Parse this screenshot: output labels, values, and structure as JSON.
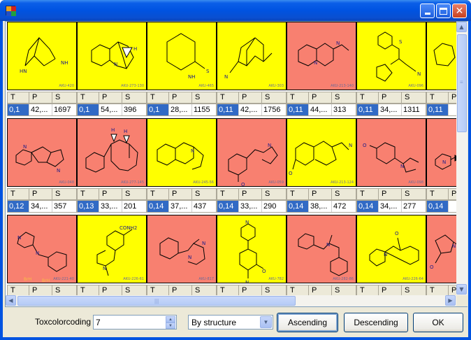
{
  "window": {
    "title": "",
    "icon_name": "app-icon",
    "icon_colors": [
      "#e8a21a",
      "#d02020",
      "#2050c8",
      "#20a040"
    ]
  },
  "colors": {
    "toxic": "#f88070",
    "nontoxic": "#ffff00",
    "selected": "#316ac5"
  },
  "grid": {
    "column_headers": [
      "T",
      "P",
      "S"
    ],
    "rows": [
      {
        "cells": [
          {
            "tox": "nontoxic",
            "code": "AKU-420",
            "t": "0,1",
            "p": "42,...",
            "s": "1697"
          },
          {
            "tox": "nontoxic",
            "code": "AKU-273-130",
            "t": "0,1",
            "p": "54,...",
            "s": "396"
          },
          {
            "tox": "nontoxic",
            "code": "AKU-465",
            "t": "0,1",
            "p": "28,...",
            "s": "1155"
          },
          {
            "tox": "nontoxic",
            "code": "AKU-303",
            "t": "0,11",
            "p": "42,...",
            "s": "1756"
          },
          {
            "tox": "toxic",
            "code": "AKU-213-140",
            "t": "0,11",
            "p": "44,...",
            "s": "313"
          },
          {
            "tox": "nontoxic",
            "code": "AKU-096",
            "t": "0,11",
            "p": "34,...",
            "s": "1311"
          },
          {
            "tox": "nontoxic",
            "code": "",
            "t": "0,11",
            "p": "",
            "s": ""
          }
        ]
      },
      {
        "cells": [
          {
            "tox": "toxic",
            "code": "AKU-048",
            "t": "0,12",
            "p": "34,...",
            "s": "357"
          },
          {
            "tox": "toxic",
            "code": "AKU-277-145",
            "t": "0,13",
            "p": "33,...",
            "s": "201"
          },
          {
            "tox": "nontoxic",
            "code": "AKU-245-56",
            "t": "0,14",
            "p": "37,...",
            "s": "437"
          },
          {
            "tox": "toxic",
            "code": "AKU-059",
            "t": "0,14",
            "p": "33,...",
            "s": "290"
          },
          {
            "tox": "nontoxic",
            "code": "AKU-213-124",
            "t": "0,14",
            "p": "38,...",
            "s": "472"
          },
          {
            "tox": "toxic",
            "code": "AKU-098",
            "t": "0,14",
            "p": "34,...",
            "s": "277"
          },
          {
            "tox": "toxic",
            "code": "",
            "t": "0,14",
            "p": "",
            "s": ""
          }
        ]
      },
      {
        "cells": [
          {
            "tox": "toxic",
            "code": "AKU-221-40",
            "t": "",
            "p": "",
            "s": ""
          },
          {
            "tox": "nontoxic",
            "code": "AKU-226-61",
            "t": "",
            "p": "",
            "s": ""
          },
          {
            "tox": "toxic",
            "code": "AKU-817",
            "t": "",
            "p": "",
            "s": ""
          },
          {
            "tox": "nontoxic",
            "code": "AKU-782",
            "t": "",
            "p": "",
            "s": ""
          },
          {
            "tox": "toxic",
            "code": "AKU-282-86",
            "t": "",
            "p": "",
            "s": ""
          },
          {
            "tox": "nontoxic",
            "code": "AKU-226-64",
            "t": "",
            "p": "",
            "s": ""
          },
          {
            "tox": "toxic",
            "code": "",
            "t": "",
            "p": "",
            "s": ""
          }
        ]
      }
    ],
    "annotations": {
      "conh2": "CONH2",
      "brh_left": "BrH",
      "brh_right": "BrH",
      "me": "H"
    }
  },
  "bottom": {
    "tox_label": "Toxcolorcoding",
    "tox_value": "7",
    "sort_value": "By structure",
    "ascending_label": "Ascending",
    "descending_label": "Descending",
    "ok_label": "OK"
  }
}
